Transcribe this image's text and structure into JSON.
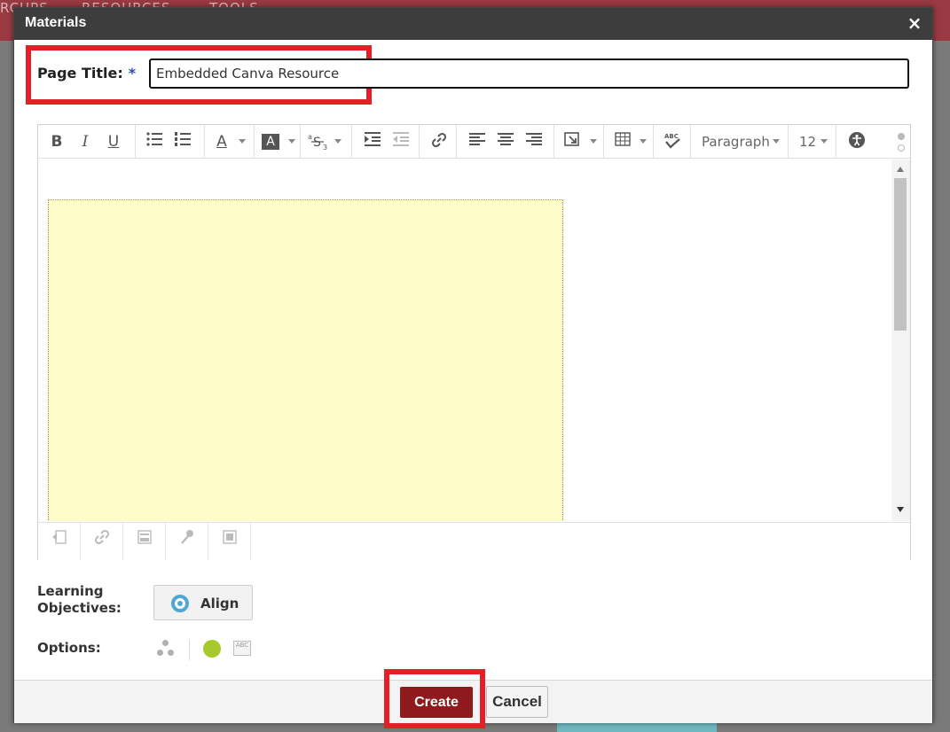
{
  "background": {
    "nav_items": [
      "RCUPS",
      "RESOURCES",
      "TOOLS"
    ]
  },
  "modal": {
    "title": "Materials",
    "close_glyph": "×"
  },
  "page_title": {
    "label": "Page Title:",
    "required_mark": "*",
    "value": "Embedded Canva Resource"
  },
  "toolbar": {
    "bold": "B",
    "italic": "I",
    "underline": "U",
    "font_color": "A",
    "highlight": "A",
    "format_dropdown": "Paragraph",
    "size_dropdown": "12"
  },
  "editor": {
    "embed_color": "#fefdca"
  },
  "learning_objectives": {
    "label_line1": "Learning",
    "label_line2": "Objectives:",
    "align_label": "Align"
  },
  "options": {
    "label": "Options:"
  },
  "footer": {
    "create_label": "Create",
    "cancel_label": "Cancel"
  },
  "colors": {
    "header_bg": "#3d3d3d",
    "highlight_red": "#e41f26",
    "create_bg": "#8e1a1d",
    "align_accent": "#4ea7d6",
    "status_green": "#a8c92b"
  }
}
